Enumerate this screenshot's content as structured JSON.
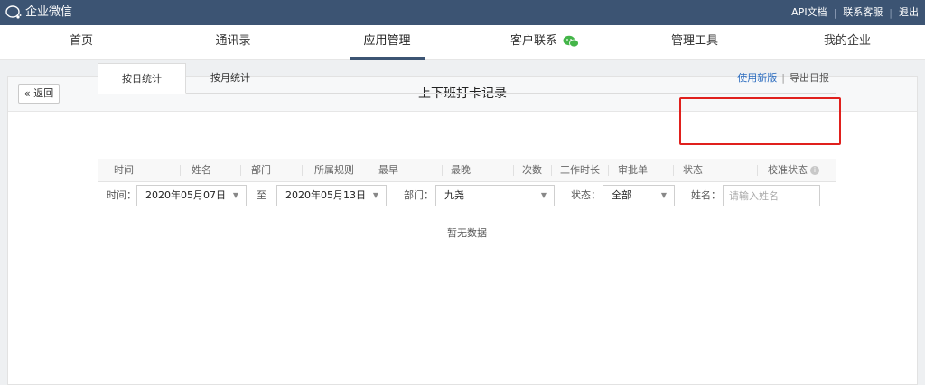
{
  "topbar": {
    "app_title": "企业微信",
    "links": [
      "API文档",
      "联系客服",
      "退出"
    ]
  },
  "nav": {
    "items": [
      "首页",
      "通讯录",
      "应用管理",
      "客户联系",
      "管理工具",
      "我的企业"
    ],
    "active": "应用管理"
  },
  "header": {
    "back_label": "« 返回",
    "title": "上下班打卡记录"
  },
  "tabs": [
    "按日统计",
    "按月统计"
  ],
  "right_links": {
    "new_version": "使用新版",
    "separator": "|",
    "export": "导出日报"
  },
  "filters": {
    "time_label": "时间：",
    "start_date": "2020年05月07日",
    "to_label": "至",
    "end_date": "2020年05月13日",
    "dept_label": "部门：",
    "dept_value": "九尧",
    "status_label": "状态：",
    "status_value": "全部",
    "name_label": "姓名：",
    "name_placeholder": "请输入姓名"
  },
  "table": {
    "columns": [
      "时间",
      "姓名",
      "部门",
      "所属规则",
      "最早",
      "最晚",
      "次数",
      "工作时长",
      "审批单",
      "状态",
      "校准状态"
    ],
    "rows": [],
    "empty_text": "暂无数据"
  },
  "colors": {
    "topbar": "#3c5473",
    "link_blue": "#2b6cbf",
    "highlight_red": "#e0201d"
  }
}
